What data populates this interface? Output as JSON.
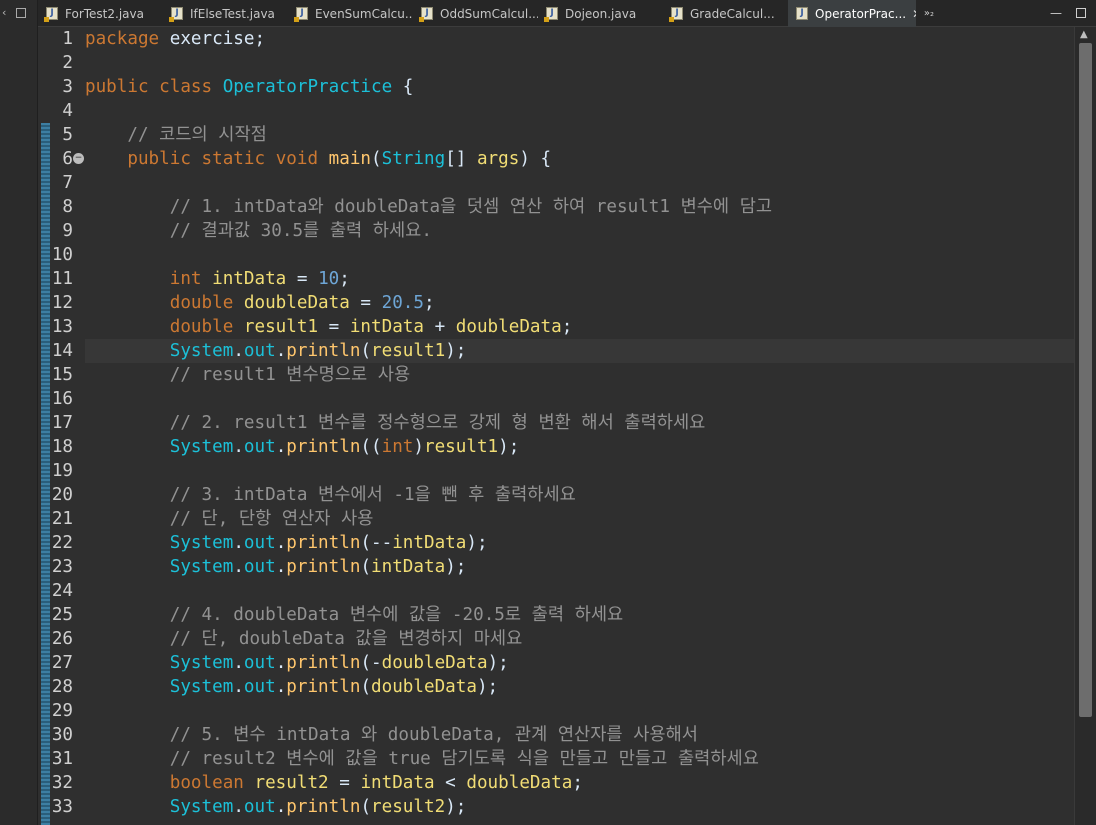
{
  "left_strip": {
    "restore_glyph": "▫"
  },
  "tabs": [
    {
      "label": "ForTest2.java",
      "active": false,
      "icon": "java-file-icon"
    },
    {
      "label": "IfElseTest.java",
      "active": false,
      "icon": "java-file-icon"
    },
    {
      "label": "EvenSumCalcu...",
      "active": false,
      "icon": "java-file-icon"
    },
    {
      "label": "OddSumCalcul...",
      "active": false,
      "icon": "java-file-icon"
    },
    {
      "label": "Dojeon.java",
      "active": false,
      "icon": "java-file-icon"
    },
    {
      "label": "GradeCalcul...",
      "active": false,
      "icon": "java-file-icon"
    },
    {
      "label": "OperatorPrac...",
      "active": true,
      "icon": "java-file-icon"
    }
  ],
  "tab_overflow": {
    "label": "»₂"
  },
  "editor": {
    "current_line": 14,
    "lines": [
      {
        "n": "1",
        "tokens": [
          [
            "kw",
            "package"
          ],
          [
            "pl",
            " exercise;"
          ]
        ]
      },
      {
        "n": "2",
        "tokens": []
      },
      {
        "n": "3",
        "tokens": [
          [
            "kw",
            "public"
          ],
          [
            "pl",
            " "
          ],
          [
            "kw",
            "class"
          ],
          [
            "pl",
            " "
          ],
          [
            "cls",
            "OperatorPractice"
          ],
          [
            "pl",
            " {"
          ]
        ]
      },
      {
        "n": "4",
        "tokens": []
      },
      {
        "n": "5",
        "tokens": [
          [
            "pl",
            "    "
          ],
          [
            "cm",
            "// 코드의 시작점"
          ]
        ]
      },
      {
        "n": "6",
        "fold": true,
        "tokens": [
          [
            "pl",
            "    "
          ],
          [
            "kw",
            "public"
          ],
          [
            "pl",
            " "
          ],
          [
            "kw",
            "static"
          ],
          [
            "pl",
            " "
          ],
          [
            "kw",
            "void"
          ],
          [
            "pl",
            " "
          ],
          [
            "mth",
            "main"
          ],
          [
            "pl",
            "("
          ],
          [
            "ty",
            "String"
          ],
          [
            "pl",
            "[] "
          ],
          [
            "var",
            "args"
          ],
          [
            "pl",
            ") {"
          ]
        ]
      },
      {
        "n": "7",
        "tokens": []
      },
      {
        "n": "8",
        "tokens": [
          [
            "pl",
            "        "
          ],
          [
            "cm",
            "// 1. intData와 doubleData을 덧셈 연산 하여 result1 변수에 담고"
          ]
        ]
      },
      {
        "n": "9",
        "tokens": [
          [
            "pl",
            "        "
          ],
          [
            "cm",
            "// 결과값 30.5를 출력 하세요."
          ]
        ]
      },
      {
        "n": "10",
        "tokens": []
      },
      {
        "n": "11",
        "tokens": [
          [
            "pl",
            "        "
          ],
          [
            "kw",
            "int"
          ],
          [
            "pl",
            " "
          ],
          [
            "var",
            "intData"
          ],
          [
            "pl",
            " = "
          ],
          [
            "num",
            "10"
          ],
          [
            "pl",
            ";"
          ]
        ]
      },
      {
        "n": "12",
        "tokens": [
          [
            "pl",
            "        "
          ],
          [
            "kw",
            "double"
          ],
          [
            "pl",
            " "
          ],
          [
            "var",
            "doubleData"
          ],
          [
            "pl",
            " = "
          ],
          [
            "num",
            "20.5"
          ],
          [
            "pl",
            ";"
          ]
        ]
      },
      {
        "n": "13",
        "tokens": [
          [
            "pl",
            "        "
          ],
          [
            "kw",
            "double"
          ],
          [
            "pl",
            " "
          ],
          [
            "var",
            "result1"
          ],
          [
            "pl",
            " = "
          ],
          [
            "var",
            "intData"
          ],
          [
            "pl",
            " + "
          ],
          [
            "var",
            "doubleData"
          ],
          [
            "pl",
            ";"
          ]
        ]
      },
      {
        "n": "14",
        "tokens": [
          [
            "pl",
            "        "
          ],
          [
            "cls",
            "System"
          ],
          [
            "pl",
            "."
          ],
          [
            "fld",
            "out"
          ],
          [
            "pl",
            "."
          ],
          [
            "mth",
            "println"
          ],
          [
            "pl",
            "("
          ],
          [
            "var",
            "result1"
          ],
          [
            "pl",
            ");"
          ]
        ]
      },
      {
        "n": "15",
        "tokens": [
          [
            "pl",
            "        "
          ],
          [
            "cm",
            "// result1 변수명으로 사용"
          ]
        ]
      },
      {
        "n": "16",
        "tokens": []
      },
      {
        "n": "17",
        "tokens": [
          [
            "pl",
            "        "
          ],
          [
            "cm",
            "// 2. result1 변수를 정수형으로 강제 형 변환 해서 출력하세요"
          ]
        ]
      },
      {
        "n": "18",
        "tokens": [
          [
            "pl",
            "        "
          ],
          [
            "cls",
            "System"
          ],
          [
            "pl",
            "."
          ],
          [
            "fld",
            "out"
          ],
          [
            "pl",
            "."
          ],
          [
            "mth",
            "println"
          ],
          [
            "pl",
            "(("
          ],
          [
            "kw",
            "int"
          ],
          [
            "pl",
            ")"
          ],
          [
            "var",
            "result1"
          ],
          [
            "pl",
            ");"
          ]
        ]
      },
      {
        "n": "19",
        "tokens": []
      },
      {
        "n": "20",
        "tokens": [
          [
            "pl",
            "        "
          ],
          [
            "cm",
            "// 3. intData 변수에서 -1을 뺀 후 출력하세요"
          ]
        ]
      },
      {
        "n": "21",
        "tokens": [
          [
            "pl",
            "        "
          ],
          [
            "cm",
            "// 단, 단항 연산자 사용"
          ]
        ]
      },
      {
        "n": "22",
        "tokens": [
          [
            "pl",
            "        "
          ],
          [
            "cls",
            "System"
          ],
          [
            "pl",
            "."
          ],
          [
            "fld",
            "out"
          ],
          [
            "pl",
            "."
          ],
          [
            "mth",
            "println"
          ],
          [
            "pl",
            "(--"
          ],
          [
            "var",
            "intData"
          ],
          [
            "pl",
            ");"
          ]
        ]
      },
      {
        "n": "23",
        "tokens": [
          [
            "pl",
            "        "
          ],
          [
            "cls",
            "System"
          ],
          [
            "pl",
            "."
          ],
          [
            "fld",
            "out"
          ],
          [
            "pl",
            "."
          ],
          [
            "mth",
            "println"
          ],
          [
            "pl",
            "("
          ],
          [
            "var",
            "intData"
          ],
          [
            "pl",
            ");"
          ]
        ]
      },
      {
        "n": "24",
        "tokens": []
      },
      {
        "n": "25",
        "tokens": [
          [
            "pl",
            "        "
          ],
          [
            "cm",
            "// 4. doubleData 변수에 값을 -20.5로 출력 하세요"
          ]
        ]
      },
      {
        "n": "26",
        "tokens": [
          [
            "pl",
            "        "
          ],
          [
            "cm",
            "// 단, doubleData 값을 변경하지 마세요"
          ]
        ]
      },
      {
        "n": "27",
        "tokens": [
          [
            "pl",
            "        "
          ],
          [
            "cls",
            "System"
          ],
          [
            "pl",
            "."
          ],
          [
            "fld",
            "out"
          ],
          [
            "pl",
            "."
          ],
          [
            "mth",
            "println"
          ],
          [
            "pl",
            "(-"
          ],
          [
            "var",
            "doubleData"
          ],
          [
            "pl",
            ");"
          ]
        ]
      },
      {
        "n": "28",
        "tokens": [
          [
            "pl",
            "        "
          ],
          [
            "cls",
            "System"
          ],
          [
            "pl",
            "."
          ],
          [
            "fld",
            "out"
          ],
          [
            "pl",
            "."
          ],
          [
            "mth",
            "println"
          ],
          [
            "pl",
            "("
          ],
          [
            "var",
            "doubleData"
          ],
          [
            "pl",
            ");"
          ]
        ]
      },
      {
        "n": "29",
        "tokens": []
      },
      {
        "n": "30",
        "tokens": [
          [
            "pl",
            "        "
          ],
          [
            "cm",
            "// 5. 변수 intData 와 doubleData, 관계 연산자를 사용해서"
          ]
        ]
      },
      {
        "n": "31",
        "tokens": [
          [
            "pl",
            "        "
          ],
          [
            "cm",
            "// result2 변수에 값을 true 담기도록 식을 만들고 만들고 출력하세요"
          ]
        ]
      },
      {
        "n": "32",
        "tokens": [
          [
            "pl",
            "        "
          ],
          [
            "kw",
            "boolean"
          ],
          [
            "pl",
            " "
          ],
          [
            "var",
            "result2"
          ],
          [
            "pl",
            " = "
          ],
          [
            "var",
            "intData"
          ],
          [
            "pl",
            " < "
          ],
          [
            "var",
            "doubleData"
          ],
          [
            "pl",
            ";"
          ]
        ]
      },
      {
        "n": "33",
        "tokens": [
          [
            "pl",
            "        "
          ],
          [
            "cls",
            "System"
          ],
          [
            "pl",
            "."
          ],
          [
            "fld",
            "out"
          ],
          [
            "pl",
            "."
          ],
          [
            "mth",
            "println"
          ],
          [
            "pl",
            "("
          ],
          [
            "var",
            "result2"
          ],
          [
            "pl",
            ");"
          ]
        ]
      }
    ]
  }
}
